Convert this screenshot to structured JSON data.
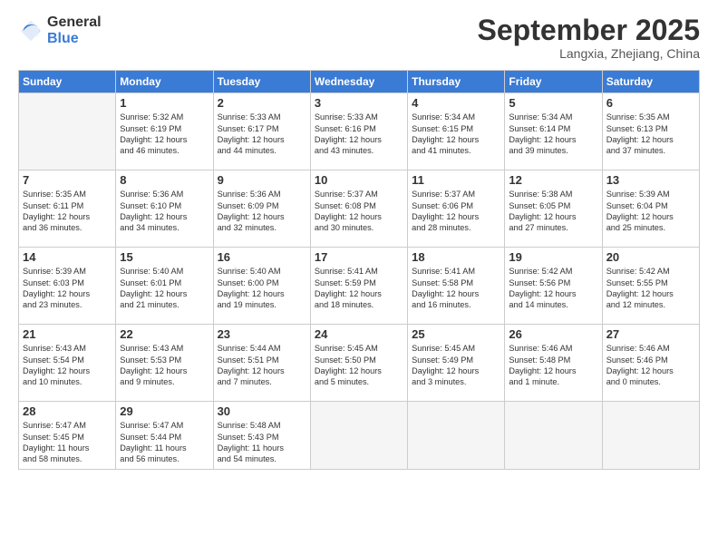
{
  "logo": {
    "general": "General",
    "blue": "Blue"
  },
  "header": {
    "month": "September 2025",
    "location": "Langxia, Zhejiang, China"
  },
  "days_header": [
    "Sunday",
    "Monday",
    "Tuesday",
    "Wednesday",
    "Thursday",
    "Friday",
    "Saturday"
  ],
  "weeks": [
    [
      {
        "day": "",
        "info": ""
      },
      {
        "day": "1",
        "info": "Sunrise: 5:32 AM\nSunset: 6:19 PM\nDaylight: 12 hours\nand 46 minutes."
      },
      {
        "day": "2",
        "info": "Sunrise: 5:33 AM\nSunset: 6:17 PM\nDaylight: 12 hours\nand 44 minutes."
      },
      {
        "day": "3",
        "info": "Sunrise: 5:33 AM\nSunset: 6:16 PM\nDaylight: 12 hours\nand 43 minutes."
      },
      {
        "day": "4",
        "info": "Sunrise: 5:34 AM\nSunset: 6:15 PM\nDaylight: 12 hours\nand 41 minutes."
      },
      {
        "day": "5",
        "info": "Sunrise: 5:34 AM\nSunset: 6:14 PM\nDaylight: 12 hours\nand 39 minutes."
      },
      {
        "day": "6",
        "info": "Sunrise: 5:35 AM\nSunset: 6:13 PM\nDaylight: 12 hours\nand 37 minutes."
      }
    ],
    [
      {
        "day": "7",
        "info": "Sunrise: 5:35 AM\nSunset: 6:11 PM\nDaylight: 12 hours\nand 36 minutes."
      },
      {
        "day": "8",
        "info": "Sunrise: 5:36 AM\nSunset: 6:10 PM\nDaylight: 12 hours\nand 34 minutes."
      },
      {
        "day": "9",
        "info": "Sunrise: 5:36 AM\nSunset: 6:09 PM\nDaylight: 12 hours\nand 32 minutes."
      },
      {
        "day": "10",
        "info": "Sunrise: 5:37 AM\nSunset: 6:08 PM\nDaylight: 12 hours\nand 30 minutes."
      },
      {
        "day": "11",
        "info": "Sunrise: 5:37 AM\nSunset: 6:06 PM\nDaylight: 12 hours\nand 28 minutes."
      },
      {
        "day": "12",
        "info": "Sunrise: 5:38 AM\nSunset: 6:05 PM\nDaylight: 12 hours\nand 27 minutes."
      },
      {
        "day": "13",
        "info": "Sunrise: 5:39 AM\nSunset: 6:04 PM\nDaylight: 12 hours\nand 25 minutes."
      }
    ],
    [
      {
        "day": "14",
        "info": "Sunrise: 5:39 AM\nSunset: 6:03 PM\nDaylight: 12 hours\nand 23 minutes."
      },
      {
        "day": "15",
        "info": "Sunrise: 5:40 AM\nSunset: 6:01 PM\nDaylight: 12 hours\nand 21 minutes."
      },
      {
        "day": "16",
        "info": "Sunrise: 5:40 AM\nSunset: 6:00 PM\nDaylight: 12 hours\nand 19 minutes."
      },
      {
        "day": "17",
        "info": "Sunrise: 5:41 AM\nSunset: 5:59 PM\nDaylight: 12 hours\nand 18 minutes."
      },
      {
        "day": "18",
        "info": "Sunrise: 5:41 AM\nSunset: 5:58 PM\nDaylight: 12 hours\nand 16 minutes."
      },
      {
        "day": "19",
        "info": "Sunrise: 5:42 AM\nSunset: 5:56 PM\nDaylight: 12 hours\nand 14 minutes."
      },
      {
        "day": "20",
        "info": "Sunrise: 5:42 AM\nSunset: 5:55 PM\nDaylight: 12 hours\nand 12 minutes."
      }
    ],
    [
      {
        "day": "21",
        "info": "Sunrise: 5:43 AM\nSunset: 5:54 PM\nDaylight: 12 hours\nand 10 minutes."
      },
      {
        "day": "22",
        "info": "Sunrise: 5:43 AM\nSunset: 5:53 PM\nDaylight: 12 hours\nand 9 minutes."
      },
      {
        "day": "23",
        "info": "Sunrise: 5:44 AM\nSunset: 5:51 PM\nDaylight: 12 hours\nand 7 minutes."
      },
      {
        "day": "24",
        "info": "Sunrise: 5:45 AM\nSunset: 5:50 PM\nDaylight: 12 hours\nand 5 minutes."
      },
      {
        "day": "25",
        "info": "Sunrise: 5:45 AM\nSunset: 5:49 PM\nDaylight: 12 hours\nand 3 minutes."
      },
      {
        "day": "26",
        "info": "Sunrise: 5:46 AM\nSunset: 5:48 PM\nDaylight: 12 hours\nand 1 minute."
      },
      {
        "day": "27",
        "info": "Sunrise: 5:46 AM\nSunset: 5:46 PM\nDaylight: 12 hours\nand 0 minutes."
      }
    ],
    [
      {
        "day": "28",
        "info": "Sunrise: 5:47 AM\nSunset: 5:45 PM\nDaylight: 11 hours\nand 58 minutes."
      },
      {
        "day": "29",
        "info": "Sunrise: 5:47 AM\nSunset: 5:44 PM\nDaylight: 11 hours\nand 56 minutes."
      },
      {
        "day": "30",
        "info": "Sunrise: 5:48 AM\nSunset: 5:43 PM\nDaylight: 11 hours\nand 54 minutes."
      },
      {
        "day": "",
        "info": ""
      },
      {
        "day": "",
        "info": ""
      },
      {
        "day": "",
        "info": ""
      },
      {
        "day": "",
        "info": ""
      }
    ]
  ]
}
